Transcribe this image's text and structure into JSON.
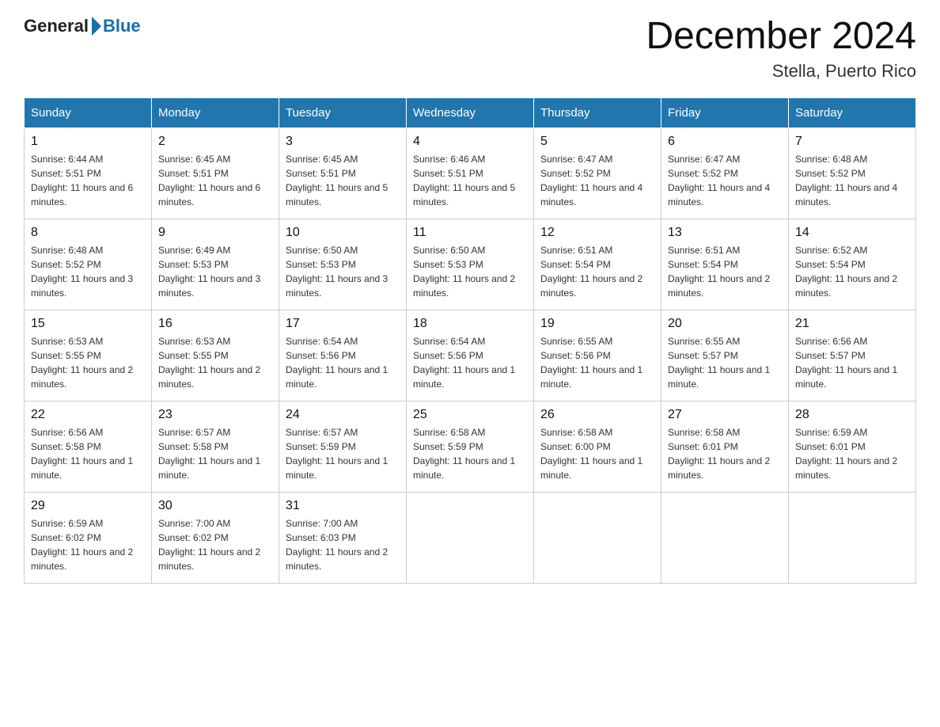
{
  "header": {
    "logo": {
      "general": "General",
      "blue": "Blue"
    },
    "title": "December 2024",
    "subtitle": "Stella, Puerto Rico"
  },
  "days_of_week": [
    "Sunday",
    "Monday",
    "Tuesday",
    "Wednesday",
    "Thursday",
    "Friday",
    "Saturday"
  ],
  "weeks": [
    [
      {
        "day": "1",
        "sunrise": "6:44 AM",
        "sunset": "5:51 PM",
        "daylight": "11 hours and 6 minutes."
      },
      {
        "day": "2",
        "sunrise": "6:45 AM",
        "sunset": "5:51 PM",
        "daylight": "11 hours and 6 minutes."
      },
      {
        "day": "3",
        "sunrise": "6:45 AM",
        "sunset": "5:51 PM",
        "daylight": "11 hours and 5 minutes."
      },
      {
        "day": "4",
        "sunrise": "6:46 AM",
        "sunset": "5:51 PM",
        "daylight": "11 hours and 5 minutes."
      },
      {
        "day": "5",
        "sunrise": "6:47 AM",
        "sunset": "5:52 PM",
        "daylight": "11 hours and 4 minutes."
      },
      {
        "day": "6",
        "sunrise": "6:47 AM",
        "sunset": "5:52 PM",
        "daylight": "11 hours and 4 minutes."
      },
      {
        "day": "7",
        "sunrise": "6:48 AM",
        "sunset": "5:52 PM",
        "daylight": "11 hours and 4 minutes."
      }
    ],
    [
      {
        "day": "8",
        "sunrise": "6:48 AM",
        "sunset": "5:52 PM",
        "daylight": "11 hours and 3 minutes."
      },
      {
        "day": "9",
        "sunrise": "6:49 AM",
        "sunset": "5:53 PM",
        "daylight": "11 hours and 3 minutes."
      },
      {
        "day": "10",
        "sunrise": "6:50 AM",
        "sunset": "5:53 PM",
        "daylight": "11 hours and 3 minutes."
      },
      {
        "day": "11",
        "sunrise": "6:50 AM",
        "sunset": "5:53 PM",
        "daylight": "11 hours and 2 minutes."
      },
      {
        "day": "12",
        "sunrise": "6:51 AM",
        "sunset": "5:54 PM",
        "daylight": "11 hours and 2 minutes."
      },
      {
        "day": "13",
        "sunrise": "6:51 AM",
        "sunset": "5:54 PM",
        "daylight": "11 hours and 2 minutes."
      },
      {
        "day": "14",
        "sunrise": "6:52 AM",
        "sunset": "5:54 PM",
        "daylight": "11 hours and 2 minutes."
      }
    ],
    [
      {
        "day": "15",
        "sunrise": "6:53 AM",
        "sunset": "5:55 PM",
        "daylight": "11 hours and 2 minutes."
      },
      {
        "day": "16",
        "sunrise": "6:53 AM",
        "sunset": "5:55 PM",
        "daylight": "11 hours and 2 minutes."
      },
      {
        "day": "17",
        "sunrise": "6:54 AM",
        "sunset": "5:56 PM",
        "daylight": "11 hours and 1 minute."
      },
      {
        "day": "18",
        "sunrise": "6:54 AM",
        "sunset": "5:56 PM",
        "daylight": "11 hours and 1 minute."
      },
      {
        "day": "19",
        "sunrise": "6:55 AM",
        "sunset": "5:56 PM",
        "daylight": "11 hours and 1 minute."
      },
      {
        "day": "20",
        "sunrise": "6:55 AM",
        "sunset": "5:57 PM",
        "daylight": "11 hours and 1 minute."
      },
      {
        "day": "21",
        "sunrise": "6:56 AM",
        "sunset": "5:57 PM",
        "daylight": "11 hours and 1 minute."
      }
    ],
    [
      {
        "day": "22",
        "sunrise": "6:56 AM",
        "sunset": "5:58 PM",
        "daylight": "11 hours and 1 minute."
      },
      {
        "day": "23",
        "sunrise": "6:57 AM",
        "sunset": "5:58 PM",
        "daylight": "11 hours and 1 minute."
      },
      {
        "day": "24",
        "sunrise": "6:57 AM",
        "sunset": "5:59 PM",
        "daylight": "11 hours and 1 minute."
      },
      {
        "day": "25",
        "sunrise": "6:58 AM",
        "sunset": "5:59 PM",
        "daylight": "11 hours and 1 minute."
      },
      {
        "day": "26",
        "sunrise": "6:58 AM",
        "sunset": "6:00 PM",
        "daylight": "11 hours and 1 minute."
      },
      {
        "day": "27",
        "sunrise": "6:58 AM",
        "sunset": "6:01 PM",
        "daylight": "11 hours and 2 minutes."
      },
      {
        "day": "28",
        "sunrise": "6:59 AM",
        "sunset": "6:01 PM",
        "daylight": "11 hours and 2 minutes."
      }
    ],
    [
      {
        "day": "29",
        "sunrise": "6:59 AM",
        "sunset": "6:02 PM",
        "daylight": "11 hours and 2 minutes."
      },
      {
        "day": "30",
        "sunrise": "7:00 AM",
        "sunset": "6:02 PM",
        "daylight": "11 hours and 2 minutes."
      },
      {
        "day": "31",
        "sunrise": "7:00 AM",
        "sunset": "6:03 PM",
        "daylight": "11 hours and 2 minutes."
      },
      null,
      null,
      null,
      null
    ]
  ]
}
